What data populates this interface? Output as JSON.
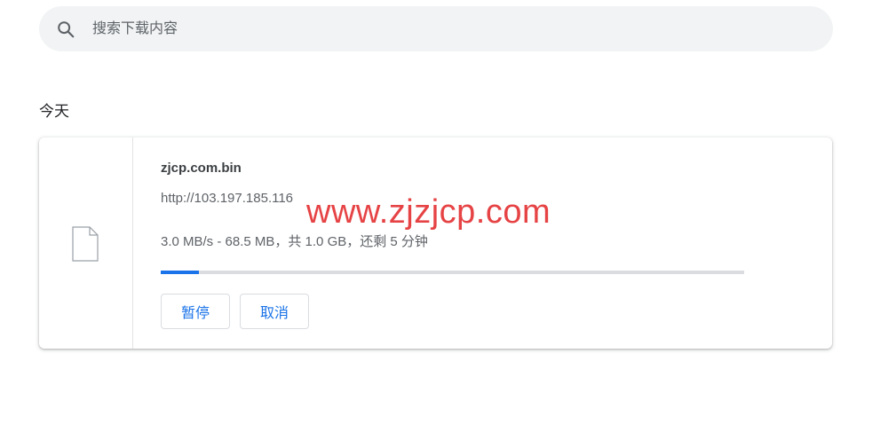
{
  "search": {
    "placeholder": "搜索下载内容",
    "icon": "search-icon"
  },
  "section": {
    "title": "今天"
  },
  "download": {
    "icon": "file-icon",
    "file_name": "zjcp.com.bin",
    "url": "http://103.197.185.116",
    "status": "3.0 MB/s - 68.5 MB，共 1.0 GB，还剩 5 分钟",
    "progress_fraction": 0.066,
    "pause_label": "暂停",
    "cancel_label": "取消"
  },
  "watermark": {
    "text": "www.zjzjcp.com"
  },
  "colors": {
    "accent": "#1a73e8",
    "search_bg": "#f1f3f4",
    "watermark": "#e64345"
  }
}
